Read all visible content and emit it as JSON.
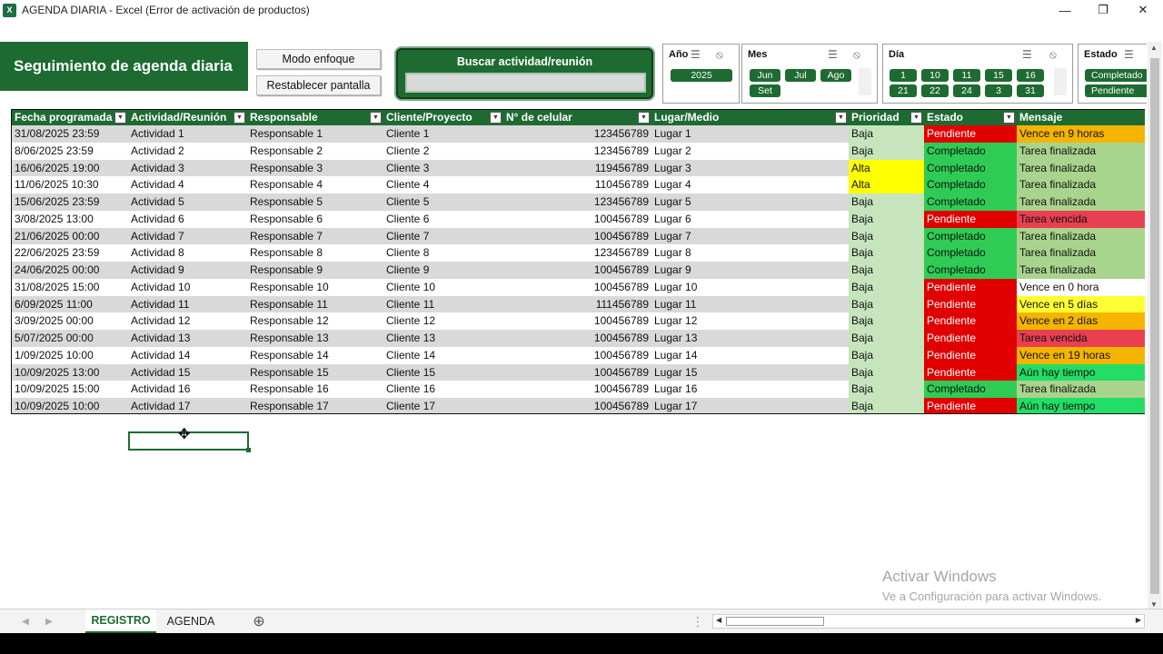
{
  "window": {
    "title": "AGENDA DIARIA - Excel (Error de activación de productos)",
    "app_icon": "excel-icon",
    "controls": [
      "minimize-icon",
      "restore-icon",
      "close-icon"
    ]
  },
  "header": {
    "title": "Seguimiento de agenda diaria",
    "btn_focus": "Modo enfoque",
    "btn_reset": "Restablecer pantalla",
    "search_label": "Buscar actividad/reunión",
    "search_value": ""
  },
  "slicers": {
    "year": {
      "title": "Año",
      "items": [
        "2025"
      ]
    },
    "month": {
      "title": "Mes",
      "items": [
        "Jun",
        "Jul",
        "Ago",
        "Set"
      ]
    },
    "day": {
      "title": "Día",
      "items": [
        "1",
        "10",
        "11",
        "15",
        "16",
        "21",
        "22",
        "24",
        "3",
        "31"
      ]
    },
    "status": {
      "title": "Estado",
      "items": [
        "Completado",
        "Pendiente"
      ]
    }
  },
  "table": {
    "columns": [
      "Fecha programada",
      "Actividad/Reunión",
      "Responsable",
      "Cliente/Proyecto",
      "N° de celular",
      "Lugar/Medio",
      "Prioridad",
      "Estado",
      "Mensaje"
    ],
    "rows": [
      [
        "31/08/2025 23:59",
        "Actividad 1",
        "Responsable 1",
        "Cliente 1",
        "123456789",
        "Lugar 1",
        "Baja",
        "Pendiente",
        "Vence en 9 horas"
      ],
      [
        "8/06/2025 23:59",
        "Actividad 2",
        "Responsable 2",
        "Cliente 2",
        "123456789",
        "Lugar 2",
        "Baja",
        "Completado",
        "Tarea finalizada"
      ],
      [
        "16/06/2025 19:00",
        "Actividad 3",
        "Responsable 3",
        "Cliente 3",
        "119456789",
        "Lugar 3",
        "Alta",
        "Completado",
        "Tarea finalizada"
      ],
      [
        "11/06/2025 10:30",
        "Actividad 4",
        "Responsable 4",
        "Cliente 4",
        "110456789",
        "Lugar 4",
        "Alta",
        "Completado",
        "Tarea finalizada"
      ],
      [
        "15/06/2025 23:59",
        "Actividad 5",
        "Responsable 5",
        "Cliente 5",
        "123456789",
        "Lugar 5",
        "Baja",
        "Completado",
        "Tarea finalizada"
      ],
      [
        "3/08/2025 13:00",
        "Actividad 6",
        "Responsable 6",
        "Cliente 6",
        "100456789",
        "Lugar 6",
        "Baja",
        "Pendiente",
        "Tarea vencida"
      ],
      [
        "21/06/2025 00:00",
        "Actividad 7",
        "Responsable 7",
        "Cliente 7",
        "100456789",
        "Lugar 7",
        "Baja",
        "Completado",
        "Tarea finalizada"
      ],
      [
        "22/06/2025 23:59",
        "Actividad 8",
        "Responsable 8",
        "Cliente 8",
        "123456789",
        "Lugar 8",
        "Baja",
        "Completado",
        "Tarea finalizada"
      ],
      [
        "24/06/2025 00:00",
        "Actividad 9",
        "Responsable 9",
        "Cliente 9",
        "100456789",
        "Lugar 9",
        "Baja",
        "Completado",
        "Tarea finalizada"
      ],
      [
        "31/08/2025 15:00",
        "Actividad 10",
        "Responsable 10",
        "Cliente 10",
        "100456789",
        "Lugar 10",
        "Baja",
        "Pendiente",
        "Vence en 0 hora"
      ],
      [
        "6/09/2025 11:00",
        "Actividad 11",
        "Responsable 11",
        "Cliente 11",
        "111456789",
        "Lugar 11",
        "Baja",
        "Pendiente",
        "Vence en 5 días"
      ],
      [
        "3/09/2025 00:00",
        "Actividad 12",
        "Responsable 12",
        "Cliente 12",
        "100456789",
        "Lugar 12",
        "Baja",
        "Pendiente",
        "Vence en 2 días"
      ],
      [
        "5/07/2025 00:00",
        "Actividad 13",
        "Responsable 13",
        "Cliente 13",
        "100456789",
        "Lugar 13",
        "Baja",
        "Pendiente",
        "Tarea vencida"
      ],
      [
        "1/09/2025 10:00",
        "Actividad 14",
        "Responsable 14",
        "Cliente 14",
        "100456789",
        "Lugar 14",
        "Baja",
        "Pendiente",
        "Vence en 19 horas"
      ],
      [
        "10/09/2025 13:00",
        "Actividad 15",
        "Responsable 15",
        "Cliente 15",
        "100456789",
        "Lugar 15",
        "Baja",
        "Pendiente",
        "Aún hay tiempo"
      ],
      [
        "10/09/2025 15:00",
        "Actividad 16",
        "Responsable 16",
        "Cliente 16",
        "100456789",
        "Lugar 16",
        "Baja",
        "Completado",
        "Tarea finalizada"
      ],
      [
        "10/09/2025 10:00",
        "Actividad 17",
        "Responsable 17",
        "Cliente 17",
        "100456789",
        "Lugar 17",
        "Baja",
        "Pendiente",
        "Aún hay tiempo"
      ]
    ]
  },
  "colors": {
    "brand_green": "#1e6b32",
    "prioridad_baja": "#c6e5bd",
    "prioridad_alta": "#ffff00",
    "estado_pendiente": "#e00000",
    "estado_completado": "#2ecc55",
    "msg_finalizada": "#a9d48d",
    "msg_vencida": "#e84050",
    "msg_horas": "#f5b400",
    "msg_dias_5": "#ffff33",
    "msg_dias_2": "#f5b400",
    "msg_tiempo": "#22dd66",
    "msg_cero": "#ffffff"
  },
  "sheet_tabs": [
    "REGISTRO",
    "AGENDA"
  ],
  "watermark": {
    "line1": "Activar Windows",
    "line2": "Ve a Configuración para activar Windows."
  }
}
